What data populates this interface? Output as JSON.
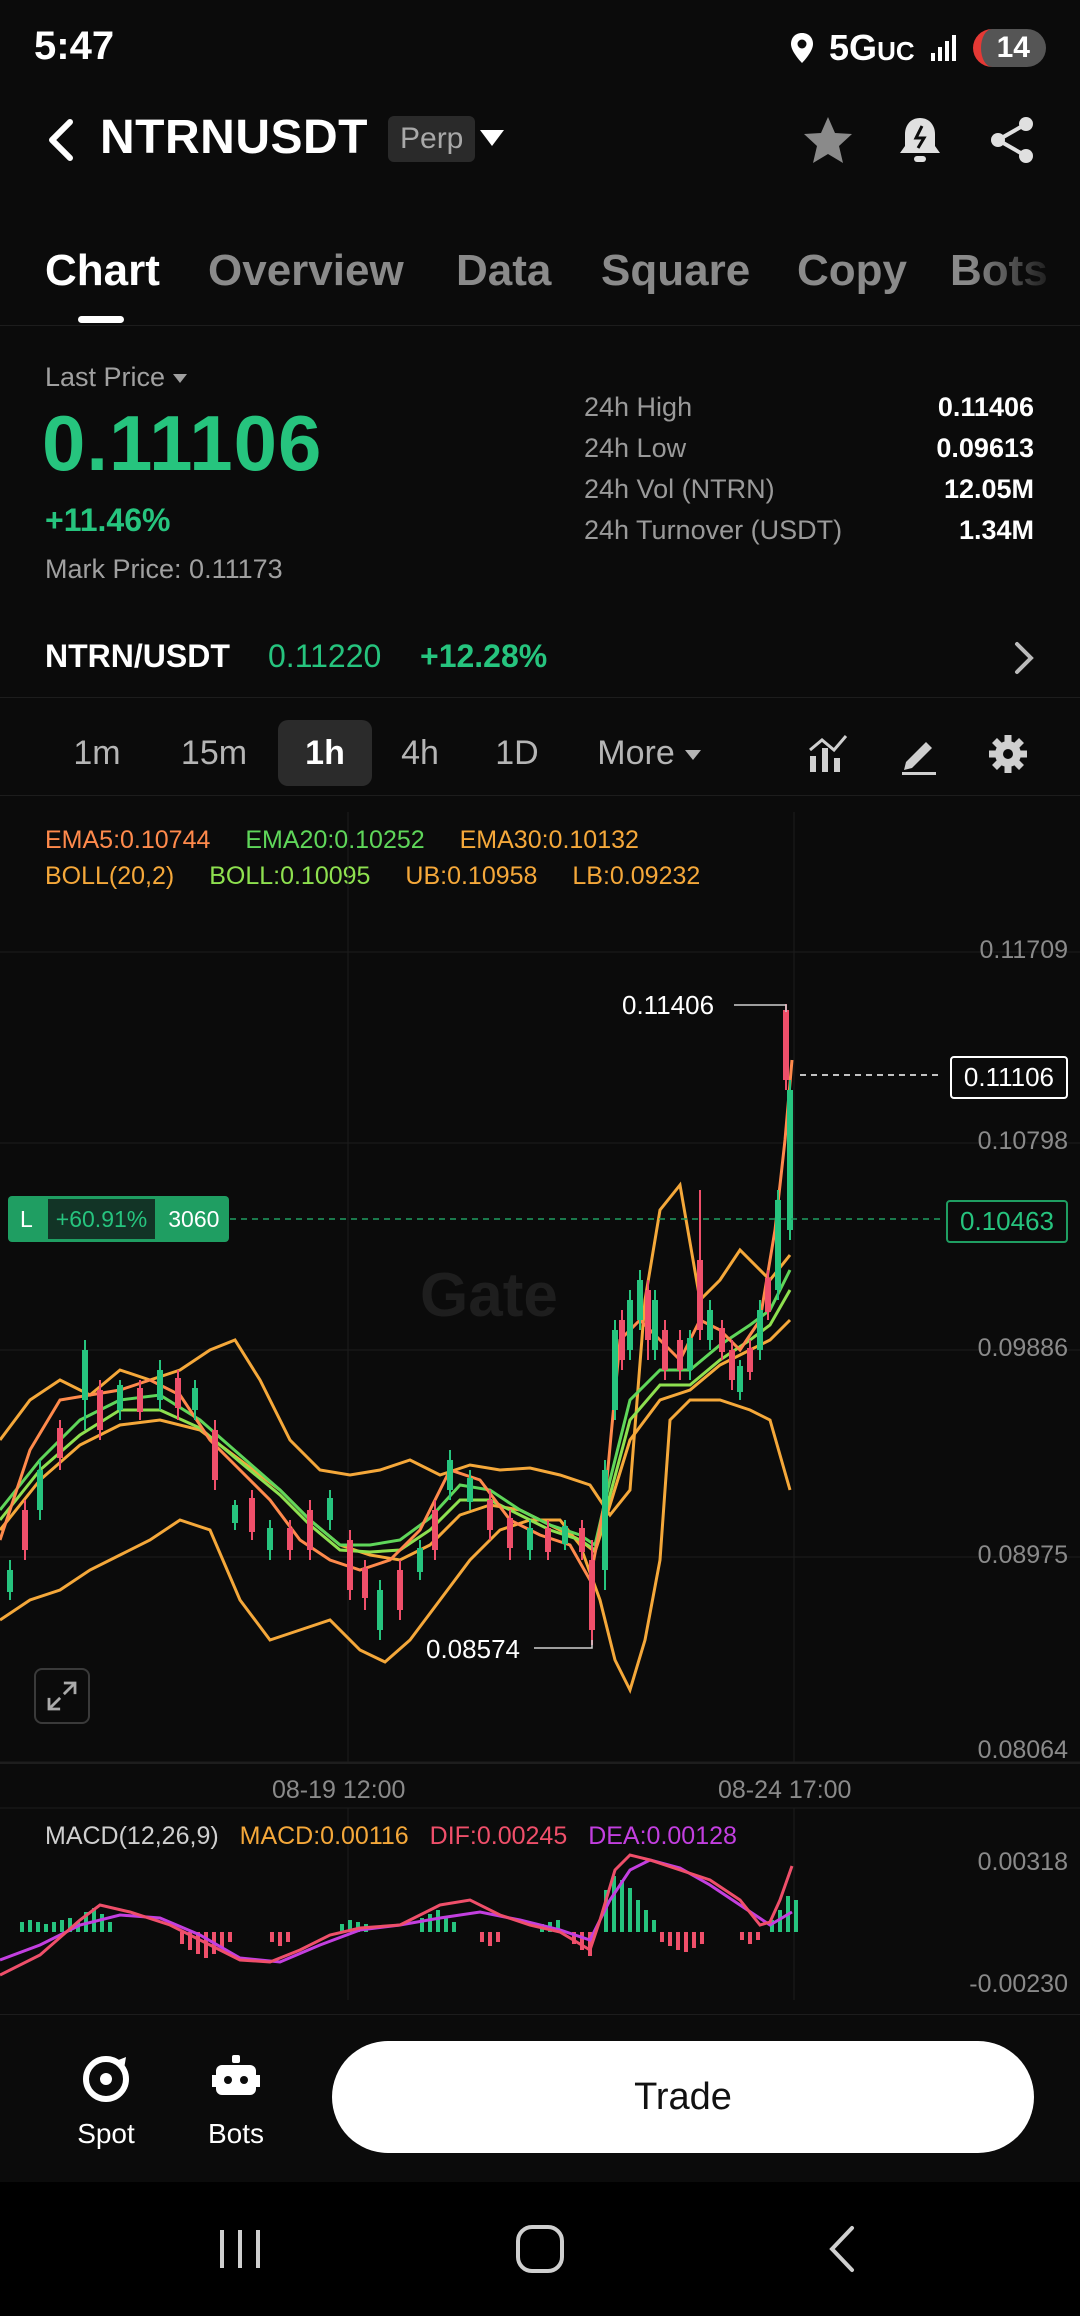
{
  "status_bar": {
    "time": "5:47",
    "network": "5G",
    "network_suffix": "UC",
    "battery": "14"
  },
  "header": {
    "pair": "NTRNUSDT",
    "contract_type": "Perp"
  },
  "tabs": [
    "Chart",
    "Overview",
    "Data",
    "Square",
    "Copy",
    "Bots"
  ],
  "ticker": {
    "last_price_label": "Last Price",
    "last_price": "0.11106",
    "change_pct": "+11.46%",
    "mark_price_label": "Mark Price:",
    "mark_price": "0.11173",
    "stats": [
      {
        "label": "24h High",
        "value": "0.11406"
      },
      {
        "label": "24h Low",
        "value": "0.09613"
      },
      {
        "label": "24h Vol (NTRN)",
        "value": "12.05M"
      },
      {
        "label": "24h Turnover (USDT)",
        "value": "1.34M"
      }
    ]
  },
  "spot": {
    "pair": "NTRN/USDT",
    "price": "0.11220",
    "change": "+12.28%"
  },
  "intervals": [
    "1m",
    "15m",
    "1h",
    "4h",
    "1D",
    "More"
  ],
  "active_interval": "1h",
  "indicators": {
    "ema5": "EMA5:0.10744",
    "ema20": "EMA20:0.10252",
    "ema30": "EMA30:0.10132",
    "boll": "BOLL(20,2)",
    "boll_mid": "BOLL:0.10095",
    "boll_ub": "UB:0.10958",
    "boll_lb": "LB:0.09232"
  },
  "chart": {
    "y_axis": [
      "0.11709",
      "0.10798",
      "0.09886",
      "0.08975",
      "0.08064"
    ],
    "current_price_tag": "0.11106",
    "entry_price_tag": "0.10463",
    "high_label": "0.11406",
    "low_label": "0.08574",
    "x_axis": [
      "08-19 12:00",
      "08-24 17:00"
    ],
    "watermark": "Gate",
    "position": {
      "side": "L",
      "pnl": "+60.91%",
      "size": "3060"
    }
  },
  "macd": {
    "title": "MACD(12,26,9)",
    "macd": "MACD:0.00116",
    "dif": "DIF:0.00245",
    "dea": "DEA:0.00128",
    "y_axis": [
      "0.00318",
      "-0.00230"
    ]
  },
  "bottom": {
    "spot_label": "Spot",
    "bots_label": "Bots",
    "trade_label": "Trade"
  },
  "colors": {
    "up": "#26c47e",
    "down": "#ef4f6a",
    "ema5": "#ff8a4c",
    "ema20": "#5fd65a",
    "ema30": "#f5a83a",
    "boll_bands": "#f5a83a",
    "boll_mid": "#8ee04f",
    "dif": "#ef4f6a",
    "dea": "#c33fe0"
  }
}
